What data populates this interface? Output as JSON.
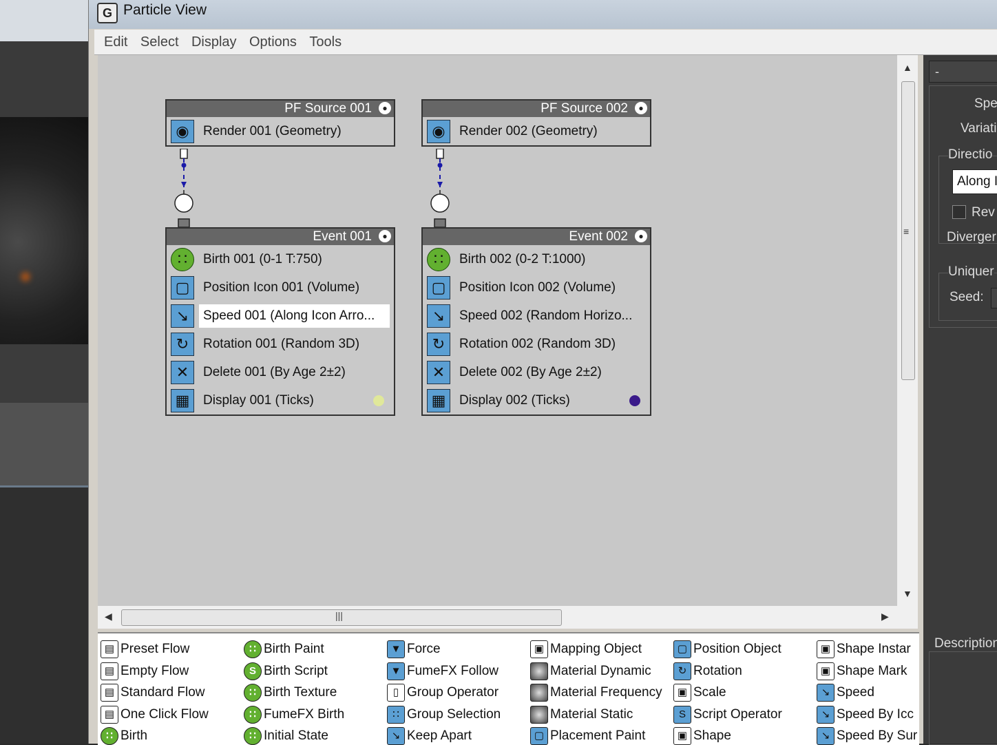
{
  "window": {
    "title": "Particle View"
  },
  "menu": [
    "Edit",
    "Select",
    "Display",
    "Options",
    "Tools"
  ],
  "colors": {
    "titlebar": "#c0ccd8",
    "canvas": "#c8c8c8",
    "header": "#666666",
    "operator": "#5b9fd3",
    "birth": "#62b030"
  },
  "nodes": [
    {
      "header": "PF Source 001",
      "ops": [
        {
          "icon": "eye-icon",
          "label": "Render 001 (Geometry)"
        }
      ]
    },
    {
      "header": "PF Source 002",
      "ops": [
        {
          "icon": "eye-icon",
          "label": "Render 002 (Geometry)"
        }
      ]
    },
    {
      "header": "Event 001",
      "ops": [
        {
          "icon": "birth-icon",
          "label": "Birth 001 (0-1 T:750)"
        },
        {
          "icon": "position-icon",
          "label": "Position Icon 001 (Volume)"
        },
        {
          "icon": "speed-icon",
          "label": "Speed 001 (Along Icon Arro..."
        },
        {
          "icon": "rotation-icon",
          "label": "Rotation 001 (Random 3D)"
        },
        {
          "icon": "delete-icon",
          "label": "Delete 001 (By Age 2±2)"
        },
        {
          "icon": "display-icon",
          "label": "Display 001 (Ticks)",
          "dot_color": "#e0e89a"
        }
      ]
    },
    {
      "header": "Event 002",
      "ops": [
        {
          "icon": "birth-icon",
          "label": "Birth 002 (0-2 T:1000)"
        },
        {
          "icon": "position-icon",
          "label": "Position Icon 002 (Volume)"
        },
        {
          "icon": "speed-icon",
          "label": "Speed 002 (Random Horizo..."
        },
        {
          "icon": "rotation-icon",
          "label": "Rotation 002 (Random 3D)"
        },
        {
          "icon": "delete-icon",
          "label": "Delete 002 (By Age 2±2)"
        },
        {
          "icon": "display-icon",
          "label": "Display 002 (Ticks)",
          "dot_color": "#3a1a8a"
        }
      ]
    }
  ],
  "depot": [
    [
      "Preset Flow",
      "Empty Flow",
      "Standard Flow",
      "One Click Flow",
      "Birth"
    ],
    [
      "Birth Paint",
      "Birth Script",
      "Birth Texture",
      "FumeFX Birth",
      "Initial State"
    ],
    [
      "Force",
      "FumeFX Follow",
      "Group Operator",
      "Group Selection",
      "Keep Apart"
    ],
    [
      "Mapping Object",
      "Material Dynamic",
      "Material Frequency",
      "Material Static",
      "Placement Paint"
    ],
    [
      "Position Object",
      "Rotation",
      "Scale",
      "Script Operator",
      "Shape"
    ],
    [
      "Shape Instar",
      "Shape Mark",
      "Speed",
      "Speed By Icc",
      "Speed By Sur"
    ]
  ],
  "right_panel": {
    "top": "-",
    "speed": "Spe",
    "variation": "Variati",
    "direction_group": "Directio",
    "direction_value": "Along I",
    "reverse": "Rev",
    "divergence": "Diverger",
    "uniqueness_group": "Uniquer",
    "seed": "Seed:",
    "description": "Description"
  }
}
